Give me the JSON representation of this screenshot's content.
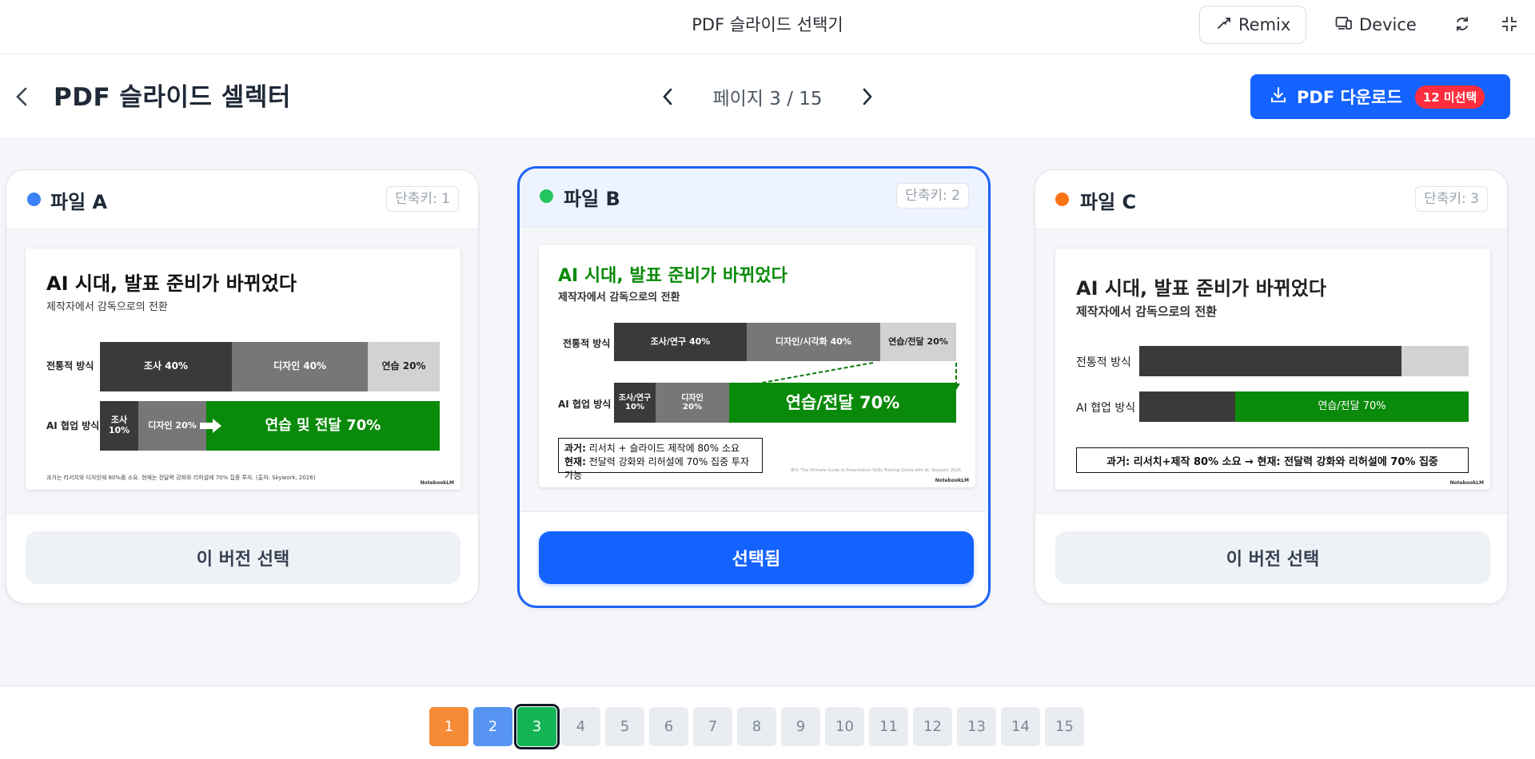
{
  "appbar": {
    "title": "PDF 슬라이드 선택기",
    "remix_label": "Remix",
    "device_label": "Device"
  },
  "header": {
    "title": "PDF 슬라이드 셀렉터",
    "pager_label": "페이지 3 / 15",
    "download_label": "PDF 다운로드",
    "unselected_badge": "12 미선택"
  },
  "colors": {
    "accent": "#1463ff",
    "file_a": "#3b82f6",
    "file_b": "#22c55e",
    "file_c": "#f97316",
    "slide_green": "#0a8a0a"
  },
  "cards": [
    {
      "name": "파일 A",
      "shortcut": "단축키: 1",
      "action": "이 버전 선택",
      "slide": {
        "title": "AI 시대, 발표 준비가 바뀌었다",
        "subtitle": "제작자에서 감독으로의 전환",
        "row1_label": "전통적 방식",
        "row1_segments": [
          "조사 40%",
          "디자인 40%",
          "연습 20%"
        ],
        "row2_label": "AI 협업 방식",
        "row2_segments": [
          "조사 10%",
          "디자인 20%",
          "연습 및 전달 70%"
        ],
        "footnote": "과거는 리서치와 디자인에 80%를 소요. 현재는 전달력 강화와 리허설에 70% 집중 투자. (출처: Skywork, 2026)",
        "logo": "NotebookLM"
      }
    },
    {
      "name": "파일 B",
      "shortcut": "단축키: 2",
      "action": "선택됨",
      "slide": {
        "title": "AI 시대, 발표 준비가 바뀌었다",
        "subtitle": "제작자에서 감독으로의 전환",
        "row1_label": "전통적 방식",
        "row1_segments": [
          "조사/연구 40%",
          "디자인/시각화 40%",
          "연습/전달 20%"
        ],
        "row2_label": "AI 협업 방식",
        "row2_segments": [
          "조사/연구 10%",
          "디자인 20%",
          "연습/전달 70%"
        ],
        "box_past_label": "과거:",
        "box_past_text": " 리서치 + 슬라이드 제작에 80% 소요",
        "box_now_label": "현재:",
        "box_now_text": " 전달력 강화와 리허설에 70% 집중 투자 가능",
        "source": "출처: The Ultimate Guide to Presentation Skills Training Online with AI, Skywork, 2026",
        "logo": "NotebookLM"
      }
    },
    {
      "name": "파일 C",
      "shortcut": "단축키: 3",
      "action": "이 버전 선택",
      "slide": {
        "title": "AI 시대, 발표 준비가 바뀌었다",
        "subtitle": "제작자에서 감독으로의 전환",
        "row1_label": "전통적 방식",
        "row2_label": "AI 협업 방식",
        "row2_green": "연습/전달 70%",
        "summary": "과거: 리서치+제작 80% 소요 → 현재: 전달력 강화와 리허설에 70% 집중",
        "logo": "NotebookLM"
      }
    }
  ],
  "pages": [
    "1",
    "2",
    "3",
    "4",
    "5",
    "6",
    "7",
    "8",
    "9",
    "10",
    "11",
    "12",
    "13",
    "14",
    "15"
  ]
}
